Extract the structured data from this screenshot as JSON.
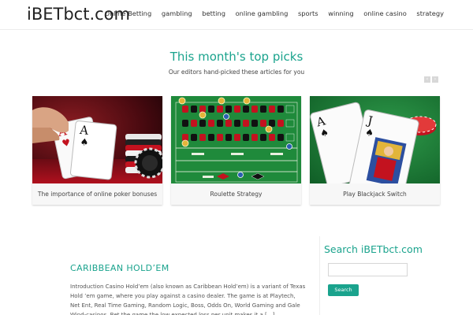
{
  "site": {
    "logo": "iBETbct.com"
  },
  "nav": {
    "items": [
      {
        "label": "Online Betting"
      },
      {
        "label": "gambling"
      },
      {
        "label": "betting"
      },
      {
        "label": "online gambling"
      },
      {
        "label": "sports"
      },
      {
        "label": "winning"
      },
      {
        "label": "online casino"
      },
      {
        "label": "strategy"
      }
    ]
  },
  "picks": {
    "title": "This month's top picks",
    "subtitle": "Our editors hand-picked these articles for you",
    "prev_icon": "chevron-left-icon",
    "next_icon": "chevron-right-icon",
    "cards": [
      {
        "caption": "The importance of online poker bonuses",
        "image": "poker-hand-chips"
      },
      {
        "caption": "Roulette Strategy",
        "image": "roulette-table"
      },
      {
        "caption": "Play Blackjack Switch",
        "image": "blackjack-cards"
      }
    ]
  },
  "post": {
    "title": "CARIBBEAN HOLD’EM",
    "excerpt": "Introduction Casino Hold’em (also known as Caribbean Hold’em) is a variant of Texas Hold ’em game, where you play against a casino dealer. The game is at Playtech, Net Ent, Real Time Gaming, Random Logic, Boss, Odds On, World Gaming and Gale Wind-casinos. Bet the game the low expected loss per unit makes it a […]"
  },
  "sidebar": {
    "search_title": "Search iBETbct.com",
    "search_value": "",
    "search_button": "Search"
  },
  "colors": {
    "accent": "#1aa38d",
    "felt": "#1f8a3b"
  }
}
